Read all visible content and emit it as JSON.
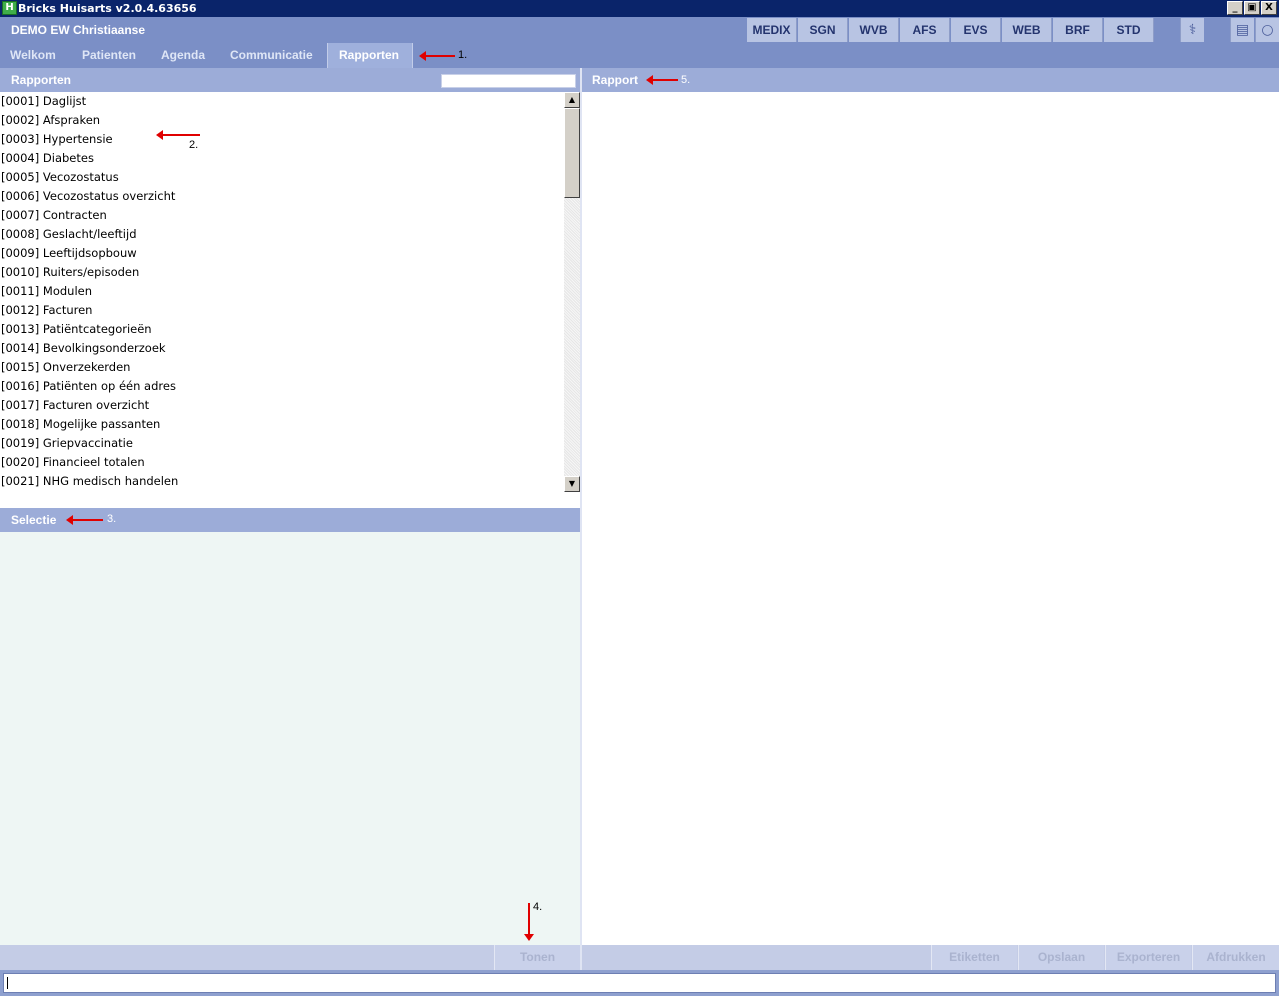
{
  "window": {
    "title": "Bricks Huisarts v2.0.4.63656",
    "app_icon": "H",
    "controls": [
      "minimize",
      "maximize",
      "close"
    ]
  },
  "header": {
    "user": "DEMO  EW Christiaanse",
    "modules": [
      "MEDIX",
      "SGN",
      "WVB",
      "AFS",
      "EVS",
      "WEB",
      "BRF",
      "STD"
    ],
    "icons": [
      "stethoscope-icon",
      "contact-icon",
      "chat-icon"
    ]
  },
  "nav": {
    "tabs": [
      "Welkom",
      "Patienten",
      "Agenda",
      "Communicatie",
      "Rapporten"
    ],
    "active_tab": "Rapporten"
  },
  "annotations": {
    "a1": "1.",
    "a2": "2.",
    "a3": "3.",
    "a4": "4.",
    "a5": "5."
  },
  "rapporten": {
    "title": "Rapporten",
    "search_value": "",
    "items": [
      "[0001] Daglijst",
      "[0002] Afspraken",
      "[0003] Hypertensie",
      "[0004] Diabetes",
      "[0005] Vecozostatus",
      "[0006] Vecozostatus overzicht",
      "[0007] Contracten",
      "[0008] Geslacht/leeftijd",
      "[0009] Leeftijdsopbouw",
      "[0010] Ruiters/episoden",
      "[0011] Modulen",
      "[0012] Facturen",
      "[0013] Patiëntcategorieën",
      "[0014] Bevolkingsonderzoek",
      "[0015] Onverzekerden",
      "[0016] Patiënten op één adres",
      "[0017] Facturen overzicht",
      "[0018] Mogelijke passanten",
      "[0019] Griepvaccinatie",
      "[0020] Financieel totalen",
      "[0021] NHG medisch handelen"
    ]
  },
  "selectie": {
    "title": "Selectie",
    "tonen_label": "Tonen"
  },
  "rapport": {
    "title": "Rapport",
    "buttons": [
      "Etiketten",
      "Opslaan",
      "Exporteren",
      "Afdrukken"
    ]
  },
  "statusbar": {
    "value": ""
  },
  "colors": {
    "titlebar": "#0a246a",
    "header": "#7b8fc6",
    "panel_head": "#9cacd8",
    "annotation_arrow": "#e00000",
    "selectie_bg": "#eef6f4"
  }
}
